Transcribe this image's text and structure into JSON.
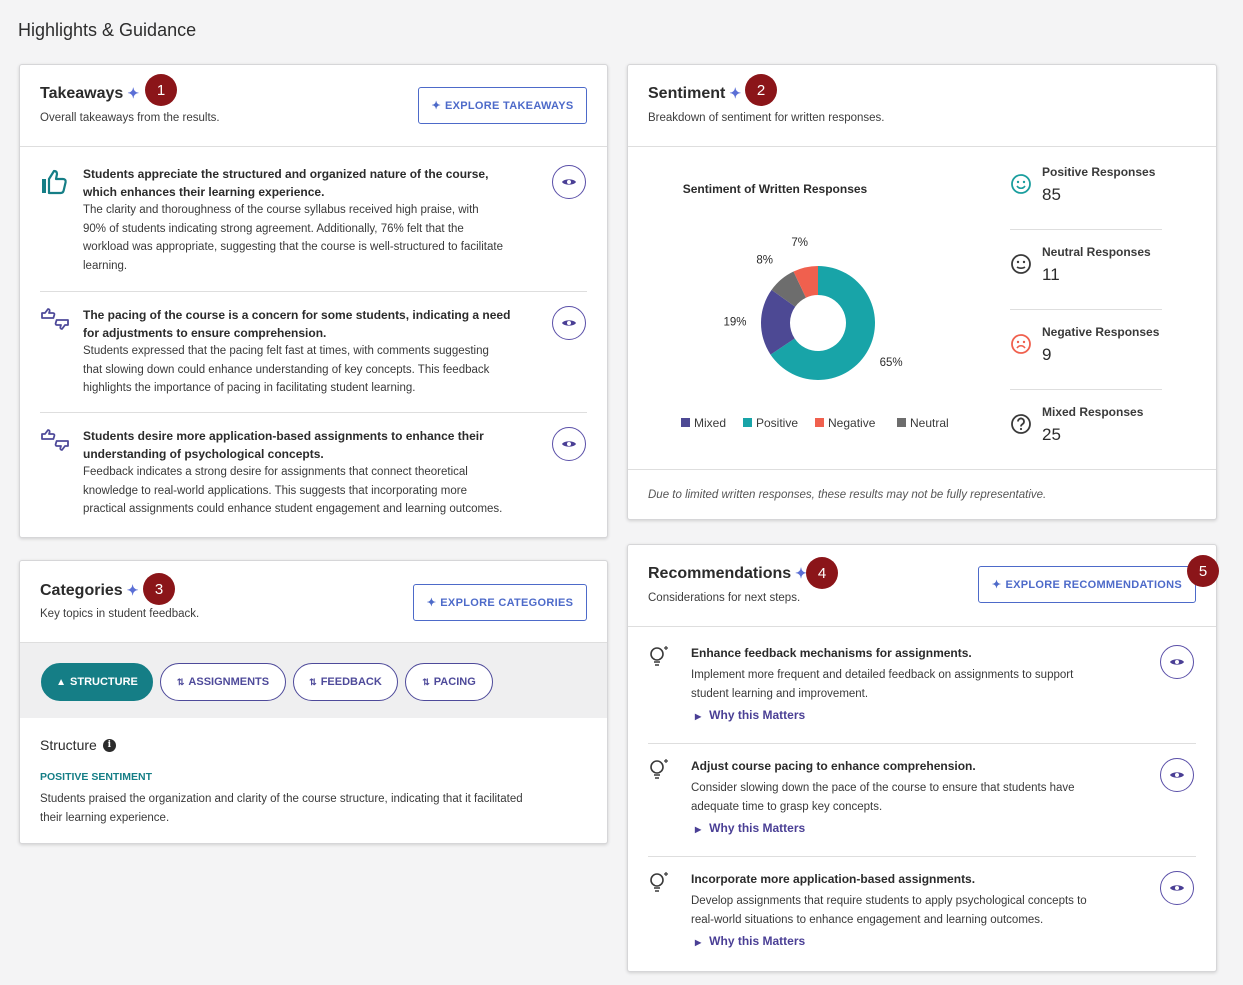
{
  "page_title": "Highlights & Guidance",
  "markers": [
    "1",
    "2",
    "3",
    "4",
    "5"
  ],
  "takeaways": {
    "title": "Takeaways",
    "subtitle": "Overall takeaways from the results.",
    "explore_label": "EXPLORE TAKEAWAYS",
    "items": [
      {
        "icon": "thumbs-up-icon",
        "title_lines": [
          "Students appreciate the structured and organized nature of the course,",
          "which enhances their learning experience."
        ],
        "body_lines": [
          "The clarity and thoroughness of the course syllabus received high praise, with",
          "90% of students indicating strong agreement. Additionally, 76% felt that the",
          "workload was appropriate, suggesting that the course is well-structured to facilitate",
          "learning."
        ]
      },
      {
        "icon": "thumbs-mixed-icon",
        "title_lines": [
          "The pacing of the course is a concern for some students, indicating a need",
          "for adjustments to ensure comprehension."
        ],
        "body_lines": [
          "Students expressed that the pacing felt fast at times, with comments suggesting",
          "that slowing down could enhance understanding of key concepts. This feedback",
          "highlights the importance of pacing in facilitating student learning."
        ]
      },
      {
        "icon": "thumbs-mixed-icon",
        "title_lines": [
          "Students desire more application-based assignments to enhance their",
          "understanding of psychological concepts."
        ],
        "body_lines": [
          "Feedback indicates a strong desire for assignments that connect theoretical",
          "knowledge to real-world applications. This suggests that incorporating more",
          "practical assignments could enhance student engagement and learning outcomes."
        ]
      }
    ]
  },
  "sentiment": {
    "title": "Sentiment",
    "subtitle": "Breakdown of sentiment for written responses.",
    "footnote": "Due to limited written responses, these results may not be fully representative.",
    "stats": [
      {
        "icon": "smile-icon",
        "label": "Positive Responses",
        "value": "85",
        "color": "#1a9e9e"
      },
      {
        "icon": "neutral-face-icon",
        "label": "Neutral Responses",
        "value": "11",
        "color": "#3a3a3a"
      },
      {
        "icon": "frown-icon",
        "label": "Negative Responses",
        "value": "9",
        "color": "#f0604e"
      },
      {
        "icon": "question-icon",
        "label": "Mixed Responses",
        "value": "25",
        "color": "#3a3a3a"
      }
    ]
  },
  "chart_data": {
    "type": "pie",
    "title": "Sentiment of Written Responses",
    "categories": [
      "Positive",
      "Mixed",
      "Neutral",
      "Negative"
    ],
    "values": [
      65,
      19,
      8,
      7
    ],
    "labels": [
      "65%",
      "19%",
      "8%",
      "7%"
    ],
    "colors": [
      "#18a4a8",
      "#4d4994",
      "#6d6d6d",
      "#f0604e"
    ],
    "legend": [
      {
        "name": "Mixed",
        "color": "#4d4994"
      },
      {
        "name": "Positive",
        "color": "#18a4a8"
      },
      {
        "name": "Negative",
        "color": "#f0604e"
      },
      {
        "name": "Neutral",
        "color": "#6d6d6d"
      }
    ],
    "legend_position": "bottom"
  },
  "categories": {
    "title": "Categories",
    "subtitle": "Key topics in student feedback.",
    "explore_label": "EXPLORE CATEGORIES",
    "chips": [
      {
        "label": "STRUCTURE",
        "active": true,
        "icon": "thumbs-up-icon"
      },
      {
        "label": "ASSIGNMENTS",
        "active": false,
        "icon": "thumbs-mixed-icon"
      },
      {
        "label": "FEEDBACK",
        "active": false,
        "icon": "thumbs-mixed-icon"
      },
      {
        "label": "PACING",
        "active": false,
        "icon": "thumbs-mixed-icon"
      }
    ],
    "detail_title": "Structure",
    "sentiment_label": "POSITIVE SENTIMENT",
    "detail_lines": [
      "Students praised the organization and clarity of the course structure, indicating that it facilitated",
      "their learning experience."
    ]
  },
  "recommendations": {
    "title": "Recommendations",
    "subtitle": "Considerations for next steps.",
    "explore_label": "EXPLORE RECOMMENDATIONS",
    "why_label": "Why this Matters",
    "items": [
      {
        "title": "Enhance feedback mechanisms for assignments.",
        "body_lines": [
          "Implement more frequent and detailed feedback on assignments to support",
          "student learning and improvement."
        ]
      },
      {
        "title": "Adjust course pacing to enhance comprehension.",
        "body_lines": [
          "Consider slowing down the pace of the course to ensure that students have",
          "adequate time to grasp key concepts."
        ]
      },
      {
        "title": "Incorporate more application-based assignments.",
        "body_lines": [
          "Develop assignments that require students to apply psychological concepts to",
          "real-world situations to enhance engagement and learning outcomes."
        ]
      }
    ]
  }
}
